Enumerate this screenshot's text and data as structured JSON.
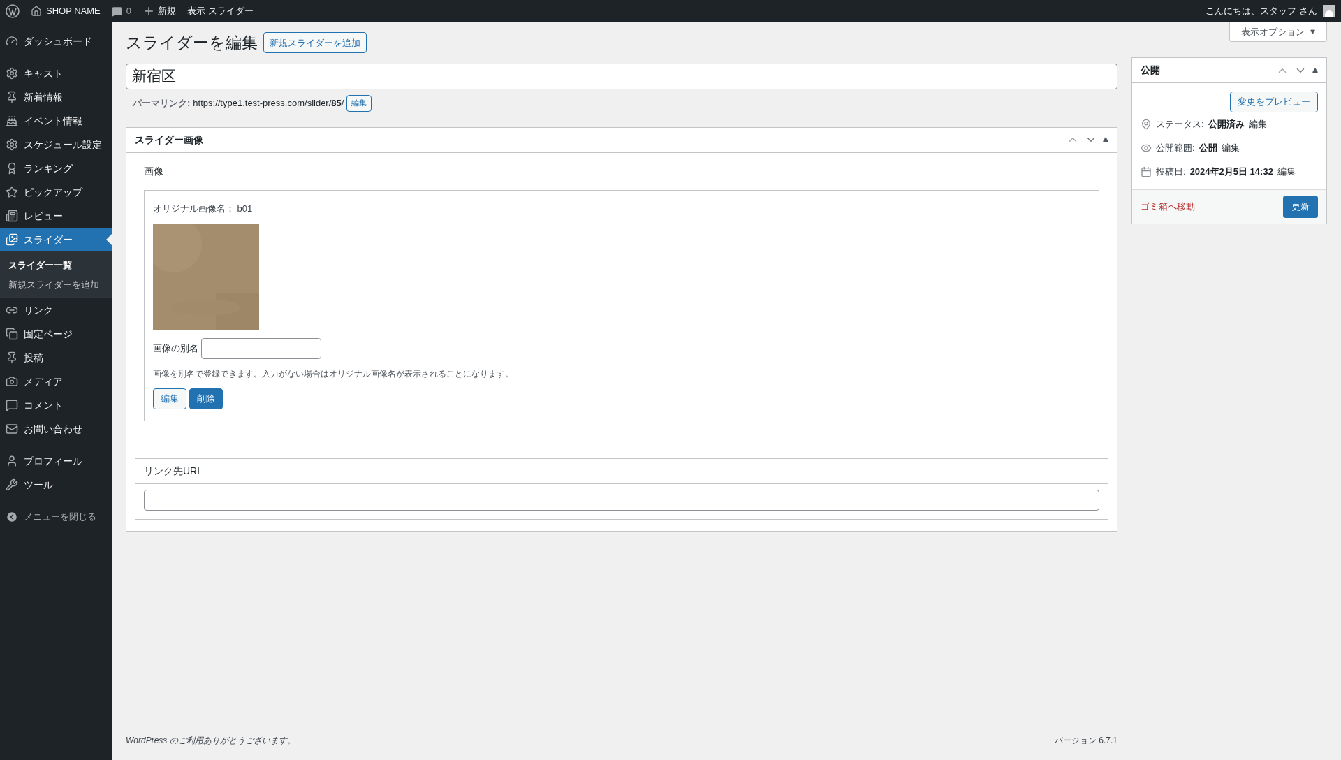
{
  "admin_bar": {
    "site_name": "SHOP NAME",
    "comments": "0",
    "new": "新規",
    "view": "表示 スライダー",
    "greeting": "こんにちは、スタッフ さん"
  },
  "sidebar": {
    "groups": [
      [
        {
          "label": "ダッシュボード",
          "selected": false
        }
      ],
      [
        {
          "label": "キャスト",
          "selected": false
        },
        {
          "label": "新着情報",
          "selected": false
        },
        {
          "label": "イベント情報",
          "selected": false
        },
        {
          "label": "スケジュール設定",
          "selected": false
        },
        {
          "label": "ランキング",
          "selected": false
        },
        {
          "label": "ピックアップ",
          "selected": false
        },
        {
          "label": "レビュー",
          "selected": false
        },
        {
          "label": "スライダー",
          "selected": true,
          "children": [
            {
              "label": "スライダー一覧",
              "selected": true
            },
            {
              "label": "新規スライダーを追加",
              "selected": false
            }
          ]
        },
        {
          "label": "リンク",
          "selected": false
        },
        {
          "label": "固定ページ",
          "selected": false
        },
        {
          "label": "投稿",
          "selected": false
        },
        {
          "label": "メディア",
          "selected": false
        },
        {
          "label": "コメント",
          "selected": false
        },
        {
          "label": "お問い合わせ",
          "selected": false
        }
      ],
      [
        {
          "label": "プロフィール",
          "selected": false
        },
        {
          "label": "ツール",
          "selected": false
        }
      ]
    ],
    "collapse": "メニューを閉じる"
  },
  "screen_options": "表示オプション",
  "page_title": "スライダーを編集",
  "add_new": "新規スライダーを追加",
  "post_title": "新宿区",
  "permalink": {
    "label": "パーマリンク:",
    "url": "https://type1.test-press.com/slider/**85**/",
    "edit": "編集"
  },
  "slider_box": {
    "title": "スライダー画像",
    "image_section": {
      "title": "画像",
      "original_name": "オリジナル画像名： b01",
      "image": {
        "kind": "picture"
      },
      "alias_label": "画像の別名",
      "help": "画像を別名で登録できます。入力がない場合はオリジナル画像名が表示されることになります。",
      "buttons": [
        "編集",
        "削除"
      ]
    },
    "link_section": {
      "title": "リンク先URL"
    }
  },
  "publish_box": {
    "title": "公開",
    "preview": "変更をプレビュー",
    "meta": [
      {
        "label": "ステータス:",
        "value": "公開済み",
        "edit": "編集"
      },
      {
        "label": "公開範囲:",
        "value": "公開",
        "edit": "編集"
      },
      {
        "label": "投稿日:",
        "value": "2024年2月5日 14:32",
        "edit": "編集"
      }
    ],
    "trash": "ゴミ箱へ移動",
    "update": "更新"
  },
  "footer": {
    "thanks": "WordPress のご利用ありがとうございます。",
    "version": "バージョン 6.7.1"
  }
}
